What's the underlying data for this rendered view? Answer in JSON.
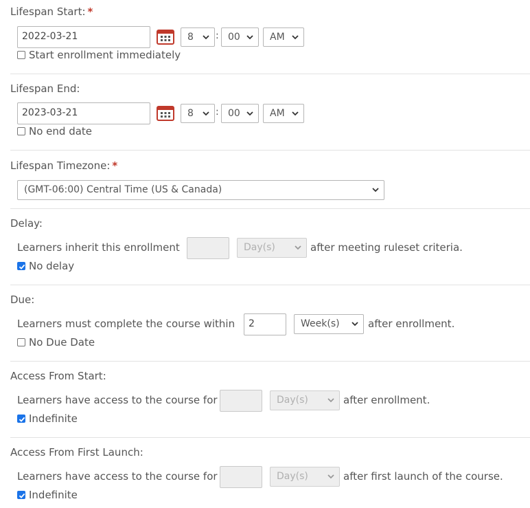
{
  "lifespan_start": {
    "label": "Lifespan Start:",
    "required_mark": "*",
    "date": "2022-03-21",
    "hour": "8",
    "minute": "00",
    "ampm": "AM",
    "checkbox_label": "Start enrollment immediately",
    "checkbox_checked": false
  },
  "lifespan_end": {
    "label": "Lifespan End:",
    "date": "2023-03-21",
    "hour": "8",
    "minute": "00",
    "ampm": "AM",
    "checkbox_label": "No end date",
    "checkbox_checked": false
  },
  "timezone": {
    "label": "Lifespan Timezone:",
    "required_mark": "*",
    "value": "(GMT-06:00) Central Time (US & Canada)"
  },
  "delay": {
    "label": "Delay:",
    "prefix": "Learners inherit this enrollment",
    "amount": "",
    "unit": "Day(s)",
    "suffix": "after meeting ruleset criteria.",
    "checkbox_label": "No delay",
    "checkbox_checked": true
  },
  "due": {
    "label": "Due:",
    "prefix": "Learners must complete the course within",
    "amount": "2",
    "unit": "Week(s)",
    "suffix": "after enrollment.",
    "checkbox_label": "No Due Date",
    "checkbox_checked": false
  },
  "access_start": {
    "label": "Access From Start:",
    "prefix": "Learners have access to the course for",
    "amount": "",
    "unit": "Day(s)",
    "suffix": "after enrollment.",
    "checkbox_label": "Indefinite",
    "checkbox_checked": true
  },
  "access_launch": {
    "label": "Access From First Launch:",
    "prefix": "Learners have access to the course for",
    "amount": "",
    "unit": "Day(s)",
    "suffix": "after first launch of the course.",
    "checkbox_label": "Indefinite",
    "checkbox_checked": true
  },
  "colors": {
    "required": "#c0392b",
    "calendar": "#c0392b",
    "checkbox_checked": "#1a73e8",
    "divider": "#e2e2e2"
  },
  "icons": {
    "calendar": "calendar-icon",
    "chevron": "chevron-down-icon",
    "check": "check-icon"
  }
}
